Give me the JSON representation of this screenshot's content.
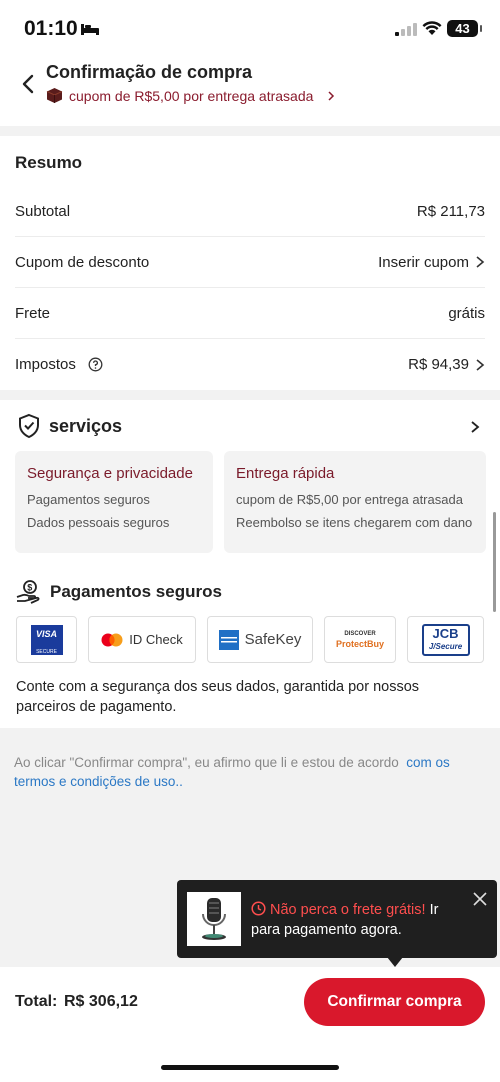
{
  "status_bar": {
    "time": "01:10",
    "battery": "43"
  },
  "header": {
    "title": "Confirmação de compra",
    "coupon_text": "cupom de R$5,00 por entrega atrasada"
  },
  "summary": {
    "title": "Resumo",
    "rows": [
      {
        "label": "Subtotal",
        "value": "R$ 211,73"
      },
      {
        "label": "Cupom de desconto",
        "value": "Inserir cupom"
      },
      {
        "label": "Frete",
        "value": "grátis"
      },
      {
        "label": "Impostos",
        "value": "R$ 94,39"
      }
    ]
  },
  "services": {
    "title": "serviços",
    "cards": [
      {
        "title": "Segurança e privacidade",
        "lines": [
          "Pagamentos seguros",
          "Dados pessoais seguros"
        ]
      },
      {
        "title": "Entrega rápida",
        "lines": [
          "cupom de R$5,00 por entrega atrasada",
          "Reembolso se itens chegarem com dano"
        ]
      }
    ]
  },
  "payments": {
    "title": "Pagamentos seguros",
    "logos": {
      "visa_top": "VISA",
      "visa_bottom": "SECURE",
      "mastercard": "ID Check",
      "safekey": "SafeKey",
      "discover_top": "DISCOVER",
      "discover_bottom": "ProtectBuy",
      "jcb_top": "JCB",
      "jcb_bottom": "J/Secure"
    },
    "description": "Conte com a segurança dos seus dados, garantida por nossos parceiros de pagamento."
  },
  "terms": {
    "text": "Ao clicar \"Confirmar compra\", eu afirmo que li e estou de acordo",
    "link": "com os termos e condições de uso.."
  },
  "toast": {
    "highlight": "Não perca o frete grátis!",
    "rest": " Ir para pagamento agora."
  },
  "footer": {
    "total_label": "Total:",
    "total_value": "R$ 306,12",
    "confirm_label": "Confirmar compra"
  },
  "colors": {
    "accent": "#d9182c",
    "coupon": "#8a1c2e",
    "link": "#2b78c5"
  }
}
